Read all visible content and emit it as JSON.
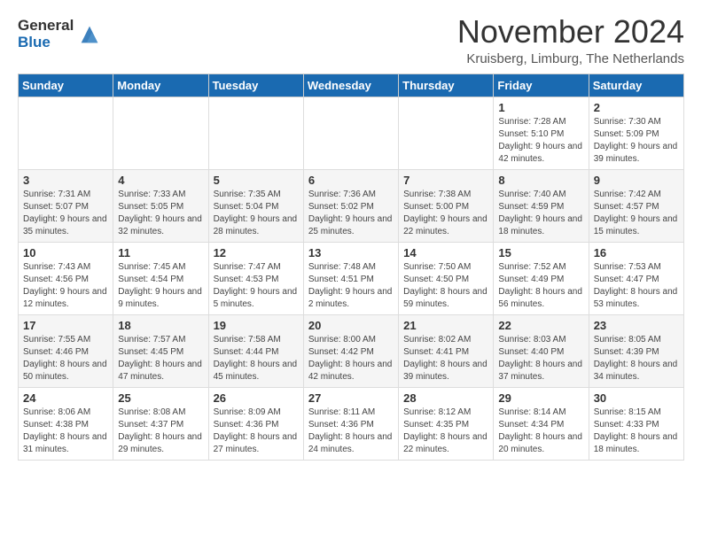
{
  "logo": {
    "line1": "General",
    "line2": "Blue"
  },
  "title": "November 2024",
  "subtitle": "Kruisberg, Limburg, The Netherlands",
  "days_of_week": [
    "Sunday",
    "Monday",
    "Tuesday",
    "Wednesday",
    "Thursday",
    "Friday",
    "Saturday"
  ],
  "weeks": [
    [
      {
        "day": "",
        "info": ""
      },
      {
        "day": "",
        "info": ""
      },
      {
        "day": "",
        "info": ""
      },
      {
        "day": "",
        "info": ""
      },
      {
        "day": "",
        "info": ""
      },
      {
        "day": "1",
        "info": "Sunrise: 7:28 AM\nSunset: 5:10 PM\nDaylight: 9 hours and 42 minutes."
      },
      {
        "day": "2",
        "info": "Sunrise: 7:30 AM\nSunset: 5:09 PM\nDaylight: 9 hours and 39 minutes."
      }
    ],
    [
      {
        "day": "3",
        "info": "Sunrise: 7:31 AM\nSunset: 5:07 PM\nDaylight: 9 hours and 35 minutes."
      },
      {
        "day": "4",
        "info": "Sunrise: 7:33 AM\nSunset: 5:05 PM\nDaylight: 9 hours and 32 minutes."
      },
      {
        "day": "5",
        "info": "Sunrise: 7:35 AM\nSunset: 5:04 PM\nDaylight: 9 hours and 28 minutes."
      },
      {
        "day": "6",
        "info": "Sunrise: 7:36 AM\nSunset: 5:02 PM\nDaylight: 9 hours and 25 minutes."
      },
      {
        "day": "7",
        "info": "Sunrise: 7:38 AM\nSunset: 5:00 PM\nDaylight: 9 hours and 22 minutes."
      },
      {
        "day": "8",
        "info": "Sunrise: 7:40 AM\nSunset: 4:59 PM\nDaylight: 9 hours and 18 minutes."
      },
      {
        "day": "9",
        "info": "Sunrise: 7:42 AM\nSunset: 4:57 PM\nDaylight: 9 hours and 15 minutes."
      }
    ],
    [
      {
        "day": "10",
        "info": "Sunrise: 7:43 AM\nSunset: 4:56 PM\nDaylight: 9 hours and 12 minutes."
      },
      {
        "day": "11",
        "info": "Sunrise: 7:45 AM\nSunset: 4:54 PM\nDaylight: 9 hours and 9 minutes."
      },
      {
        "day": "12",
        "info": "Sunrise: 7:47 AM\nSunset: 4:53 PM\nDaylight: 9 hours and 5 minutes."
      },
      {
        "day": "13",
        "info": "Sunrise: 7:48 AM\nSunset: 4:51 PM\nDaylight: 9 hours and 2 minutes."
      },
      {
        "day": "14",
        "info": "Sunrise: 7:50 AM\nSunset: 4:50 PM\nDaylight: 8 hours and 59 minutes."
      },
      {
        "day": "15",
        "info": "Sunrise: 7:52 AM\nSunset: 4:49 PM\nDaylight: 8 hours and 56 minutes."
      },
      {
        "day": "16",
        "info": "Sunrise: 7:53 AM\nSunset: 4:47 PM\nDaylight: 8 hours and 53 minutes."
      }
    ],
    [
      {
        "day": "17",
        "info": "Sunrise: 7:55 AM\nSunset: 4:46 PM\nDaylight: 8 hours and 50 minutes."
      },
      {
        "day": "18",
        "info": "Sunrise: 7:57 AM\nSunset: 4:45 PM\nDaylight: 8 hours and 47 minutes."
      },
      {
        "day": "19",
        "info": "Sunrise: 7:58 AM\nSunset: 4:44 PM\nDaylight: 8 hours and 45 minutes."
      },
      {
        "day": "20",
        "info": "Sunrise: 8:00 AM\nSunset: 4:42 PM\nDaylight: 8 hours and 42 minutes."
      },
      {
        "day": "21",
        "info": "Sunrise: 8:02 AM\nSunset: 4:41 PM\nDaylight: 8 hours and 39 minutes."
      },
      {
        "day": "22",
        "info": "Sunrise: 8:03 AM\nSunset: 4:40 PM\nDaylight: 8 hours and 37 minutes."
      },
      {
        "day": "23",
        "info": "Sunrise: 8:05 AM\nSunset: 4:39 PM\nDaylight: 8 hours and 34 minutes."
      }
    ],
    [
      {
        "day": "24",
        "info": "Sunrise: 8:06 AM\nSunset: 4:38 PM\nDaylight: 8 hours and 31 minutes."
      },
      {
        "day": "25",
        "info": "Sunrise: 8:08 AM\nSunset: 4:37 PM\nDaylight: 8 hours and 29 minutes."
      },
      {
        "day": "26",
        "info": "Sunrise: 8:09 AM\nSunset: 4:36 PM\nDaylight: 8 hours and 27 minutes."
      },
      {
        "day": "27",
        "info": "Sunrise: 8:11 AM\nSunset: 4:36 PM\nDaylight: 8 hours and 24 minutes."
      },
      {
        "day": "28",
        "info": "Sunrise: 8:12 AM\nSunset: 4:35 PM\nDaylight: 8 hours and 22 minutes."
      },
      {
        "day": "29",
        "info": "Sunrise: 8:14 AM\nSunset: 4:34 PM\nDaylight: 8 hours and 20 minutes."
      },
      {
        "day": "30",
        "info": "Sunrise: 8:15 AM\nSunset: 4:33 PM\nDaylight: 8 hours and 18 minutes."
      }
    ]
  ]
}
